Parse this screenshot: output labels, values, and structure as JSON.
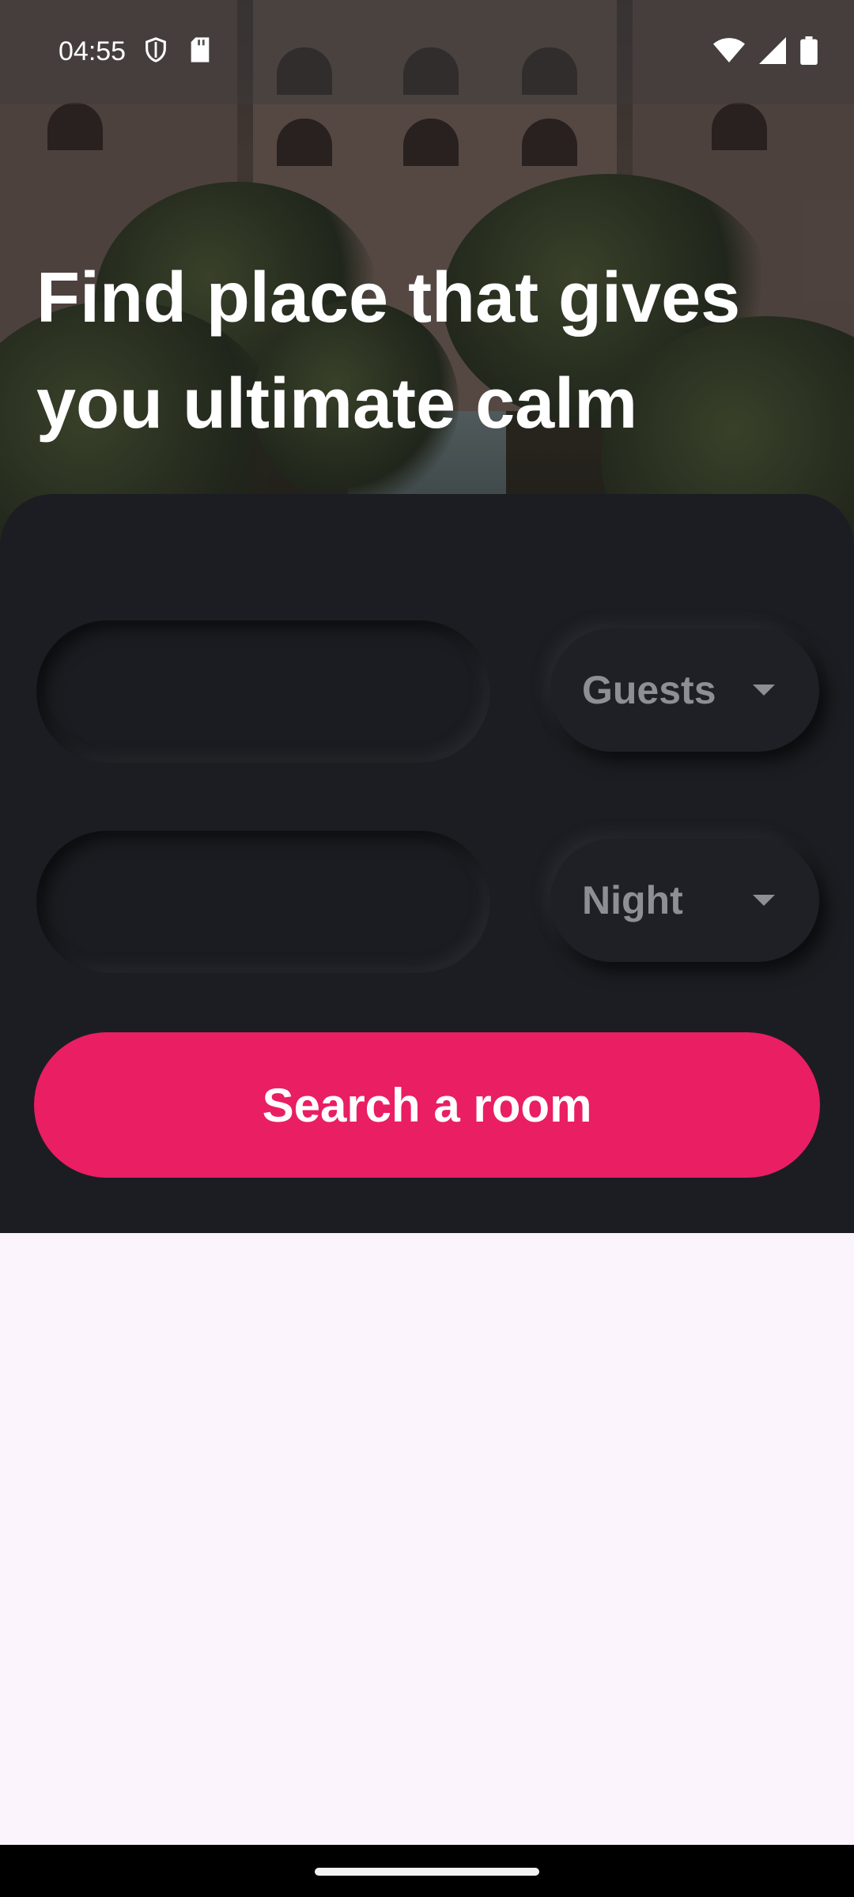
{
  "status_bar": {
    "time": "04:55",
    "left_icons": [
      "shield-icon",
      "sd-card-icon"
    ],
    "right_icons": [
      "wifi-icon",
      "signal-icon",
      "battery-icon"
    ]
  },
  "hero": {
    "headline_line1": "Find place that gives",
    "headline_line2": "you ultimate calm"
  },
  "search_form": {
    "field1_value": "",
    "field2_value": "",
    "guests_label": "Guests",
    "night_label": "Night",
    "search_button_label": "Search a room"
  },
  "colors": {
    "accent": "#e91e63",
    "panel": "#1c1d22",
    "background": "#fcf4fc"
  }
}
